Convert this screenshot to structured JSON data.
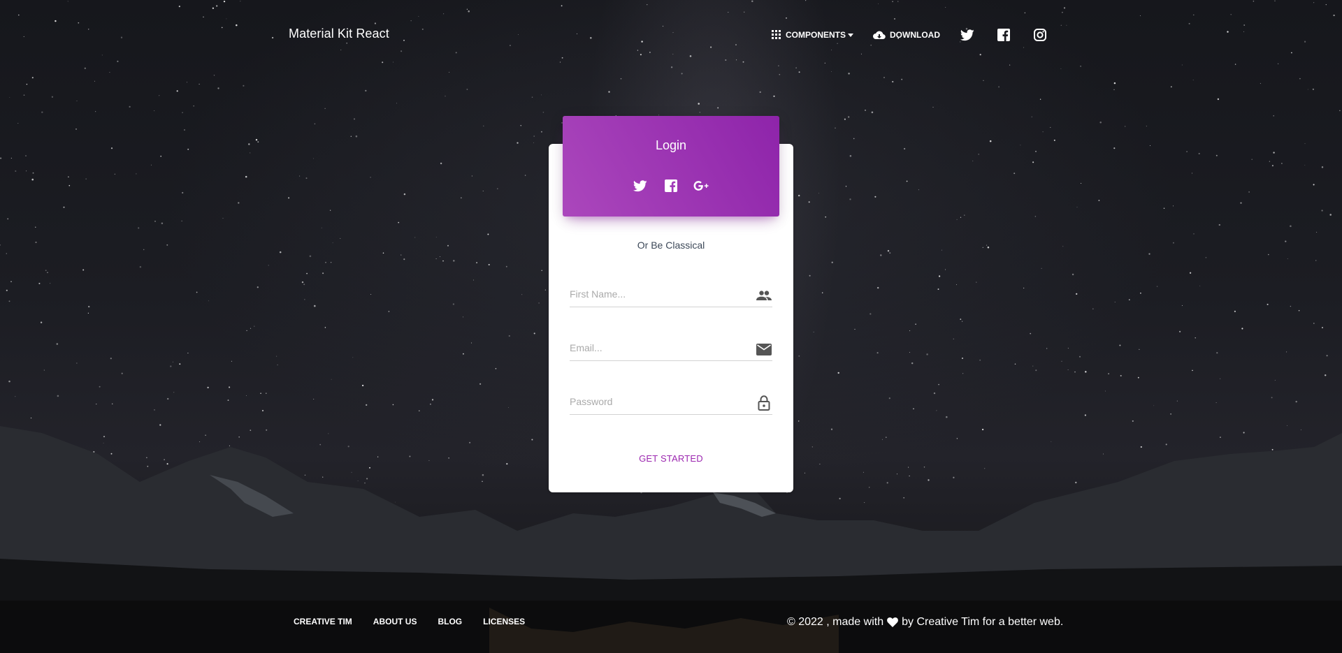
{
  "header": {
    "brand": "Material Kit React",
    "nav": {
      "components_label": "Components",
      "download_label": "Download"
    },
    "social": [
      "twitter-icon",
      "facebook-icon",
      "instagram-icon"
    ]
  },
  "login_card": {
    "title": "Login",
    "social_buttons": [
      "twitter-icon",
      "facebook-icon",
      "google-plus-icon"
    ],
    "divider_text": "Or Be Classical",
    "fields": {
      "first_name": {
        "placeholder": "First Name...",
        "value": "",
        "icon": "people-icon"
      },
      "email": {
        "placeholder": "Email...",
        "value": "",
        "icon": "email-icon"
      },
      "password": {
        "placeholder": "Password",
        "value": "",
        "icon": "lock-icon"
      }
    },
    "cta_label": "Get started"
  },
  "footer": {
    "links": [
      "Creative Tim",
      "About us",
      "Blog",
      "Licenses"
    ],
    "copyright_prefix": "© 2022 , made with",
    "copyright_suffix": "by Creative Tim for a better web."
  },
  "colors": {
    "accent": "#9c27b0",
    "header_gradient_start": "#ab47bc",
    "header_gradient_end": "#8e24aa"
  }
}
